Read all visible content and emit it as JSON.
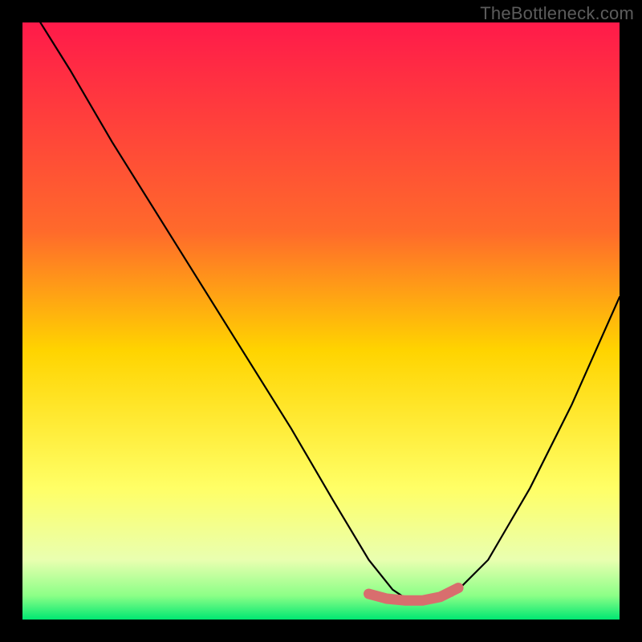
{
  "watermark": "TheBottleneck.com",
  "chart_data": {
    "type": "line",
    "title": "",
    "xlabel": "",
    "ylabel": "",
    "xlim": [
      0,
      100
    ],
    "ylim": [
      0,
      100
    ],
    "background_gradient": {
      "stops": [
        {
          "offset": 0,
          "color": "#ff1a4a"
        },
        {
          "offset": 35,
          "color": "#ff6a2b"
        },
        {
          "offset": 55,
          "color": "#ffd400"
        },
        {
          "offset": 78,
          "color": "#ffff66"
        },
        {
          "offset": 90,
          "color": "#e9ffb0"
        },
        {
          "offset": 96,
          "color": "#8cff87"
        },
        {
          "offset": 100,
          "color": "#00e772"
        }
      ]
    },
    "series": [
      {
        "name": "bottleneck-curve",
        "color": "#000000",
        "x": [
          3,
          8,
          15,
          25,
          35,
          45,
          52,
          58,
          62,
          65,
          68,
          72,
          78,
          85,
          92,
          100
        ],
        "y": [
          100,
          92,
          80,
          64,
          48,
          32,
          20,
          10,
          5,
          3,
          3,
          4,
          10,
          22,
          36,
          54
        ]
      }
    ],
    "highlight": {
      "name": "sweet-spot",
      "color": "#d86e6e",
      "x": [
        58,
        61,
        64,
        67,
        70,
        73
      ],
      "y": [
        4.3,
        3.5,
        3.2,
        3.2,
        3.8,
        5.3
      ]
    }
  }
}
